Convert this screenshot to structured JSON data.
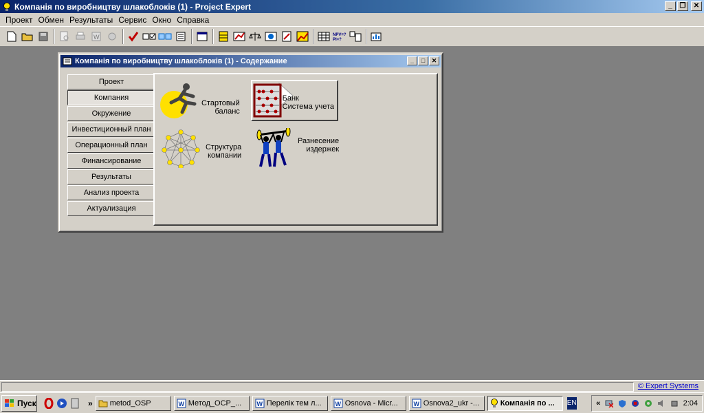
{
  "app": {
    "title": "Компанія по виробництву шлакоблоків (1) - Project Expert"
  },
  "menu": [
    "Проект",
    "Обмен",
    "Результаты",
    "Сервис",
    "Окно",
    "Справка"
  ],
  "child": {
    "title": "Компанія по виробництву шлакоблоків (1) - Содержание",
    "nav": [
      "Проект",
      "Компания",
      "Окружение",
      "Инвестиционный план",
      "Операционный план",
      "Финансирование",
      "Результаты",
      "Анализ проекта",
      "Актуализация"
    ],
    "active_index": 1,
    "items": {
      "start_balance": [
        "Стартовый",
        "баланс"
      ],
      "bank": [
        "Банк",
        "Система учета"
      ],
      "structure": [
        "Структура",
        "компании"
      ],
      "costs": [
        "Разнесение",
        "издержек"
      ]
    }
  },
  "status": {
    "link": "© Expert Systems"
  },
  "taskbar": {
    "start": "Пуск",
    "tasks": [
      {
        "label": "metod_OSP",
        "icon": "folder-icon"
      },
      {
        "label": "Метод_ОСР_...",
        "icon": "word-icon"
      },
      {
        "label": "Перелік тем л...",
        "icon": "word-icon"
      },
      {
        "label": "Osnova - Micr...",
        "icon": "word-icon"
      },
      {
        "label": "Osnova2_ukr -...",
        "icon": "word-icon"
      },
      {
        "label": "Компанія по ...",
        "icon": "bulb-icon"
      }
    ],
    "lang": "EN",
    "clock": "2:04"
  }
}
